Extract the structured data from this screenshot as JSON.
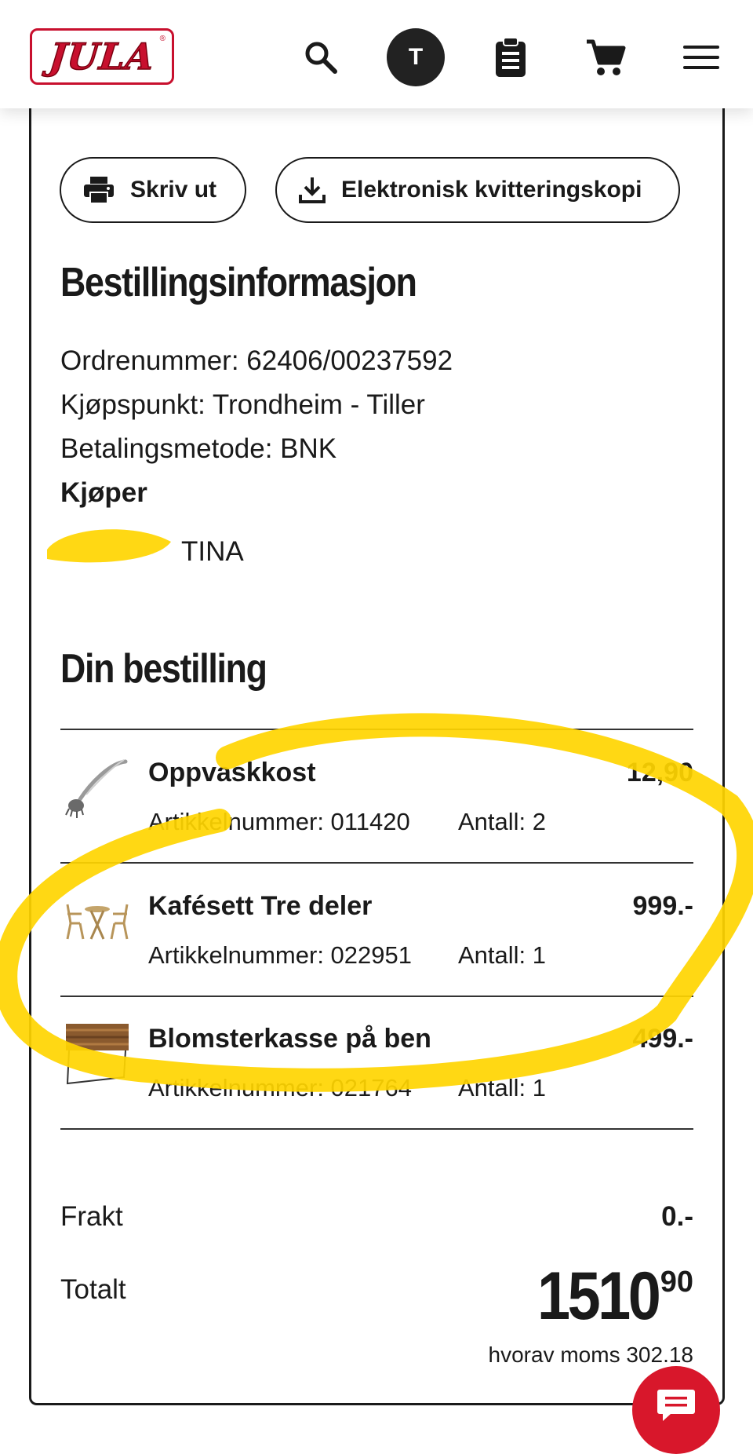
{
  "header": {
    "logo_text": "JULA",
    "logo_mark": "®",
    "avatar_initial": "T",
    "icons": [
      "search-icon",
      "clipboard-icon",
      "cart-icon",
      "hamburger-menu-icon"
    ]
  },
  "actions": {
    "print_label": "Skriv ut",
    "receipt_label": "Elektronisk kvitteringskopi"
  },
  "order_info": {
    "heading": "Bestillingsinformasjon",
    "order_number": "Ordrenummer: 62406/00237592",
    "store": "Kjøpspunkt: Trondheim - Tiller",
    "payment": "Betalingsmetode: BNK",
    "buyer_label": "Kjøper",
    "buyer_name": "TINA"
  },
  "order": {
    "heading": "Din bestilling",
    "items": [
      {
        "name": "Oppvaskkost",
        "price": "12,90",
        "article": "Artikkelnummer: 011420",
        "qty": "Antall: 2",
        "thumb": "dish-brush-image"
      },
      {
        "name": "Kafésett Tre deler",
        "price": "999.-",
        "article": "Artikkelnummer: 022951",
        "qty": "Antall: 1",
        "thumb": "cafe-set-image"
      },
      {
        "name": "Blomsterkasse på ben",
        "price": "499.-",
        "article": "Artikkelnummer: 021764",
        "qty": "Antall: 1",
        "thumb": "planter-box-image"
      }
    ]
  },
  "summary": {
    "shipping_label": "Frakt",
    "shipping_value": "0.-",
    "total_label": "Totalt",
    "total_int": "1510",
    "total_dec": "90",
    "vat": "hvorav moms 302.18"
  },
  "colors": {
    "brand_red": "#c8102e",
    "chat_red": "#d8172b",
    "highlight_yellow": "#ffd500",
    "text": "#1a1a1a"
  }
}
